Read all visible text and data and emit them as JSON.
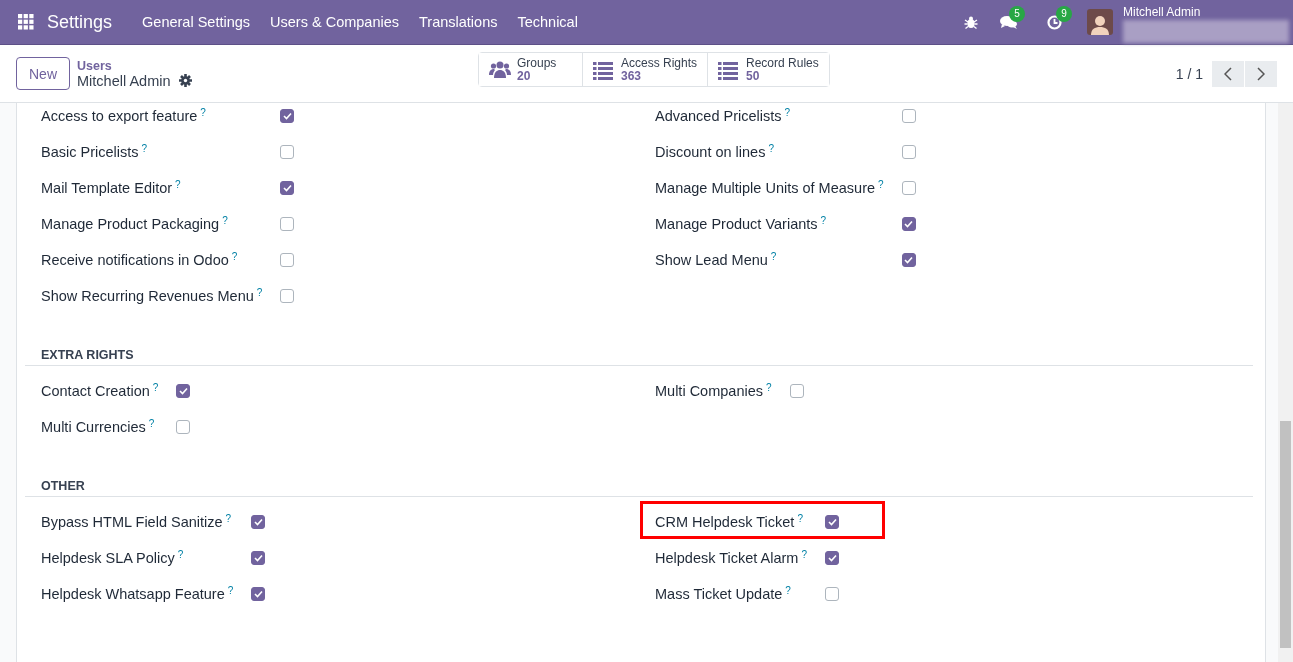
{
  "navbar": {
    "app_title": "Settings",
    "menu": [
      "General Settings",
      "Users & Companies",
      "Translations",
      "Technical"
    ],
    "message_count": "5",
    "activity_count": "9",
    "user_name": "Mitchell Admin"
  },
  "control_panel": {
    "new_button": "New",
    "breadcrumb": "Users",
    "record_title": "Mitchell Admin",
    "smart_buttons": [
      {
        "kind": "groups",
        "label": "Groups",
        "count": "20"
      },
      {
        "kind": "list",
        "label": "Access Rights",
        "count": "363"
      },
      {
        "kind": "list",
        "label": "Record Rules",
        "count": "50"
      }
    ],
    "pager": "1 / 1"
  },
  "sections": [
    {
      "left": [
        {
          "label": "Access to export feature",
          "help": "?",
          "checked": true,
          "highlighted": false
        },
        {
          "label": "Basic Pricelists",
          "help": "?",
          "checked": false,
          "highlighted": false
        },
        {
          "label": "Mail Template Editor",
          "help": "?",
          "checked": true,
          "highlighted": false
        },
        {
          "label": "Manage Product Packaging",
          "help": "?",
          "checked": false,
          "highlighted": false
        },
        {
          "label": "Receive notifications in Odoo",
          "help": "?",
          "checked": false,
          "highlighted": false
        },
        {
          "label": "Show Recurring Revenues Menu",
          "help": "?",
          "checked": false,
          "highlighted": false
        }
      ],
      "right": [
        {
          "label": "Advanced Pricelists",
          "help": "?",
          "checked": false,
          "highlighted": false
        },
        {
          "label": "Discount on lines",
          "help": "?",
          "checked": false,
          "highlighted": false
        },
        {
          "label": "Manage Multiple Units of Measure",
          "help": "?",
          "checked": false,
          "highlighted": false
        },
        {
          "label": "Manage Product Variants",
          "help": "?",
          "checked": true,
          "highlighted": false
        },
        {
          "label": "Show Lead Menu",
          "help": "?",
          "checked": true,
          "highlighted": false
        }
      ]
    },
    {
      "title": "EXTRA RIGHTS",
      "left": [
        {
          "label": "Contact Creation",
          "help": "?",
          "checked": true,
          "highlighted": false
        },
        {
          "label": "Multi Currencies",
          "help": "?",
          "checked": false,
          "highlighted": false
        }
      ],
      "right": [
        {
          "label": "Multi Companies",
          "help": "?",
          "checked": false,
          "highlighted": false
        }
      ]
    },
    {
      "title": "OTHER",
      "left": [
        {
          "label": "Bypass HTML Field Sanitize",
          "help": "?",
          "checked": true,
          "highlighted": false
        },
        {
          "label": "Helpdesk SLA Policy",
          "help": "?",
          "checked": true,
          "highlighted": false
        },
        {
          "label": "Helpdesk Whatsapp Feature",
          "help": "?",
          "checked": true,
          "highlighted": false
        }
      ],
      "right": [
        {
          "label": "CRM Helpdesk Ticket",
          "help": "?",
          "checked": true,
          "highlighted": true
        },
        {
          "label": "Helpdesk Ticket Alarm",
          "help": "?",
          "checked": true,
          "highlighted": false
        },
        {
          "label": "Mass Ticket Update",
          "help": "?",
          "checked": false,
          "highlighted": false
        }
      ]
    }
  ]
}
